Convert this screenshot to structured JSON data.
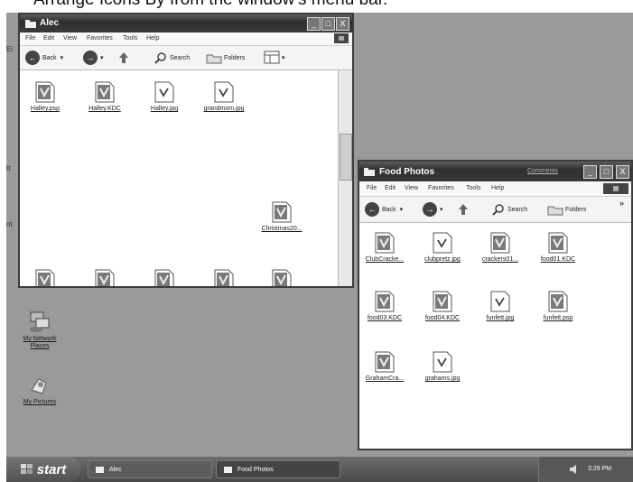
{
  "caption": "Arrange Icons By from the window's menu bar.",
  "desktop": {
    "icons": [
      {
        "label": "My Network Places",
        "icon": "network-places-icon"
      },
      {
        "label": "My Pictures",
        "icon": "my-pictures-icon"
      }
    ]
  },
  "alec_window": {
    "title": "Alec",
    "menu": [
      "File",
      "Edit",
      "View",
      "Favorites",
      "Tools",
      "Help"
    ],
    "toolbar": {
      "back": "Back",
      "search": "Search",
      "folders": "Folders"
    },
    "files": [
      "Halley.psp",
      "Halley.KDC",
      "Halley.jpg",
      "grandmom.jpg",
      "Christmas20..."
    ],
    "controls": {
      "minimize": "_",
      "maximize": "□",
      "close": "X"
    }
  },
  "food_window": {
    "title": "Food Photos",
    "title_extra": "Comments",
    "menu": [
      "File",
      "Edit",
      "View",
      "Favorites",
      "Tools",
      "Help"
    ],
    "toolbar": {
      "back": "Back",
      "search": "Search",
      "folders": "Folders"
    },
    "files": [
      "ClubCracke...",
      "clubpretz.jpg",
      "crackers01...",
      "food01.KDC",
      "food03.KDC",
      "food04.KDC",
      "funfett.jpg",
      "funfett.psp",
      "GrahamCra...",
      "grahams.jpg"
    ],
    "controls": {
      "minimize": "_",
      "maximize": "□",
      "close": "X"
    }
  },
  "taskbar": {
    "start": "start",
    "tasks": [
      "Alec",
      "Food Photos"
    ],
    "clock": "3:29 PM"
  }
}
